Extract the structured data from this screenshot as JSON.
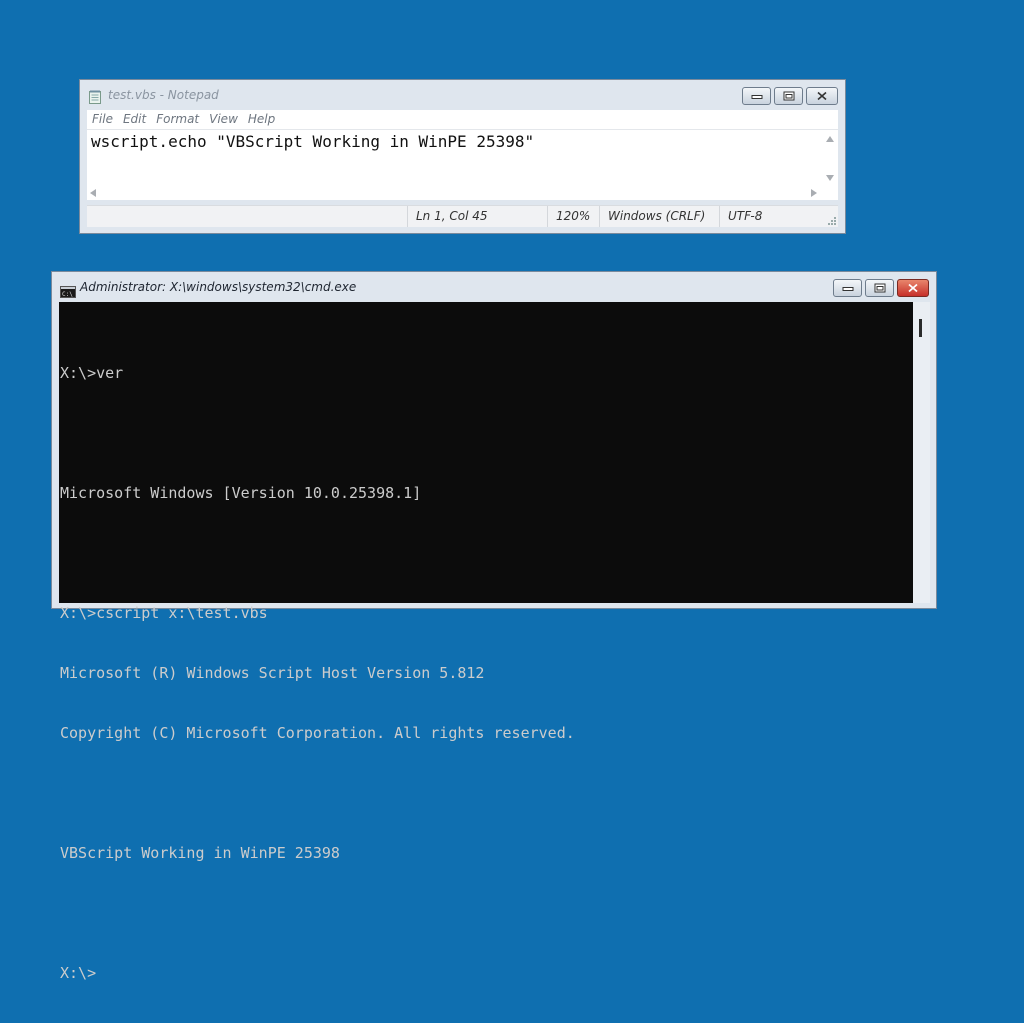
{
  "desktop": {
    "background": "#0f6fb0"
  },
  "notepad": {
    "title": "test.vbs - Notepad",
    "menu": [
      "File",
      "Edit",
      "Format",
      "View",
      "Help"
    ],
    "content": "wscript.echo \"VBScript Working in WinPE 25398\"",
    "status": {
      "position": "Ln 1, Col 45",
      "zoom": "120%",
      "line_ending": "Windows (CRLF)",
      "encoding": "UTF-8"
    },
    "icon": "notepad-icon"
  },
  "cmd": {
    "title": "Administrator: X:\\windows\\system32\\cmd.exe",
    "icon": "console-icon",
    "close_color": "#c7302a",
    "lines": [
      "X:\\>ver",
      "",
      "Microsoft Windows [Version 10.0.25398.1]",
      "",
      "X:\\>cscript x:\\test.vbs",
      "Microsoft (R) Windows Script Host Version 5.812",
      "Copyright (C) Microsoft Corporation. All rights reserved.",
      "",
      "VBScript Working in WinPE 25398",
      "",
      "X:\\>"
    ]
  }
}
